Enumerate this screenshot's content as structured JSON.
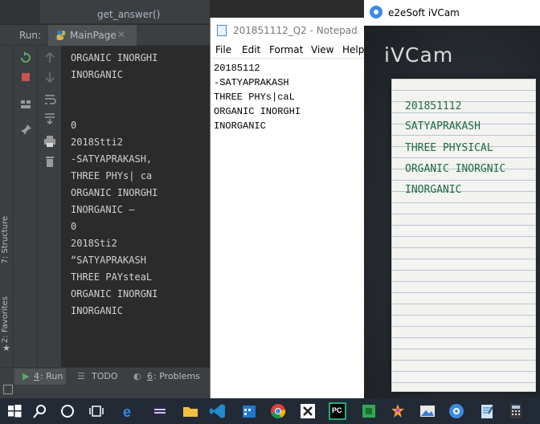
{
  "ide": {
    "function_label": "get_answer()",
    "run_label": "Run:",
    "run_tab": "MainPage",
    "close_glyph": "✕",
    "console_lines": [
      "ORGANIC INORGHI",
      "INORGANIC",
      "",
      "",
      "0",
      "2018Stti2",
      "-SATYAPRAKASH,",
      "THREE PHYs| ca",
      "ORGANIC INORGHI",
      "INORGANIC —",
      "0",
      "2018Sti2",
      "“SATYAPRAKASH",
      "THREE PAYsteaL",
      "ORGANIC INORGNI",
      "INORGANIC"
    ],
    "side_labels": {
      "structure": "7: Structure",
      "favorites": "2: Favorites"
    },
    "bottom_tabs": [
      {
        "number": "4",
        "label": ": Run"
      },
      {
        "label": "TODO"
      },
      {
        "number": "6",
        "label": ": Problems"
      }
    ],
    "colors": {
      "bg": "#2b2b2b",
      "panel": "#3c3f41",
      "text": "#d0d0d0"
    }
  },
  "notepad": {
    "title": "201851112_Q2 - Notepad",
    "menu": [
      "File",
      "Edit",
      "Format",
      "View",
      "Help"
    ],
    "lines": [
      "20185112",
      "-SATYAPRAKASH",
      "THREE PHYs|caL",
      "ORGANIC INORGHI",
      "INORGANIC"
    ]
  },
  "ivcam": {
    "title": "e2eSoft iVCam",
    "logo": "iVCam",
    "handwriting": [
      "201851112",
      "SATYAPRAKASH",
      "THREE PHYSICAL",
      "ORGANIC INORGNIC",
      "INORGANIC"
    ],
    "ink_color": "#1b6b46"
  },
  "taskbar": {
    "icons": [
      "windows-start",
      "search",
      "cortana",
      "task-view",
      "edge",
      "eclipse",
      "file-explorer",
      "vscode",
      "calendar",
      "chrome",
      "xampp",
      "pycharm",
      "app-green",
      "paint",
      "photos",
      "ivcam",
      "notepad",
      "calculator"
    ],
    "background": "#222a35"
  }
}
